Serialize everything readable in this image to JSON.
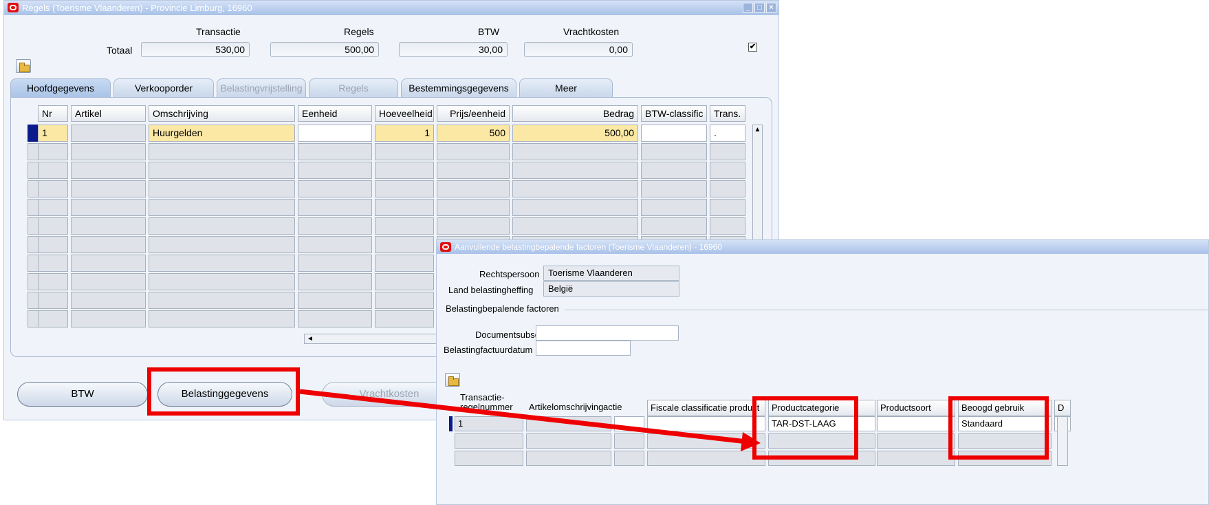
{
  "main_window": {
    "title": "Regels (Toerisme Vlaanderen) - Provincie Limburg, 16960",
    "window_buttons": [
      "_",
      "□",
      "×"
    ],
    "totals": {
      "label": "Totaal",
      "transactie_label": "Transactie",
      "transactie_value": "530,00",
      "regels_label": "Regels",
      "regels_value": "500,00",
      "btw_label": "BTW",
      "btw_value": "30,00",
      "vrachtkosten_label": "Vrachtkosten",
      "vrachtkosten_value": "0,00",
      "checkbox_checked": true,
      "checkbox_mark": "✔"
    },
    "tabs": [
      {
        "label": "Hoofdgegevens",
        "state": "active"
      },
      {
        "label": "Verkooporder",
        "state": "enabled"
      },
      {
        "label": "Belastingvrijstelling",
        "state": "disabled"
      },
      {
        "label": "Regels",
        "state": "disabled"
      },
      {
        "label": "Bestemmingsgegevens",
        "state": "enabled"
      },
      {
        "label": "Meer",
        "state": "enabled"
      }
    ],
    "table": {
      "columns": [
        "Nr",
        "Artikel",
        "Omschrijving",
        "Eenheid",
        "Hoeveelheid",
        "Prijs/eenheid",
        "Bedrag",
        "BTW-classific",
        "Trans."
      ],
      "rows": [
        {
          "nr": "1",
          "artikel": "",
          "omschrijving": "Huurgelden",
          "eenheid": "",
          "hoeveelheid": "1",
          "prijs": "500",
          "bedrag": "500,00",
          "btw": "",
          "trans": "."
        }
      ],
      "hscroll_arrow": "◄",
      "vscroll_arrow": "▲"
    },
    "buttons": {
      "btw": "BTW",
      "belastinggegevens": "Belastinggegevens",
      "vrachtkosten": "Vrachtkosten"
    }
  },
  "sub_window": {
    "title": "Aanvullende belastingbepalende factoren (Toerisme Vlaanderen) - 16960",
    "rechtspersoon_label": "Rechtspersoon",
    "rechtspersoon_value": "Toerisme Vlaanderen",
    "land_label": "Land belastingheffing",
    "land_value": "België",
    "section_label": "Belastingbepalende factoren",
    "documentsubsoort_label": "Documentsubsoort",
    "documentsubsoort_value": "",
    "factuurdatum_label": "Belastingfactuurdatum",
    "factuurdatum_value": "",
    "table": {
      "columns": [
        "Transactie-\nregelnummer",
        "Artikelomschrijving",
        "actie",
        "Fiscale classificatie product",
        "Productcategorie",
        "Productsoort",
        "Beoogd gebruik",
        "D"
      ],
      "col_regelnummer_line1": "Transactie-",
      "col_regelnummer_line2": "regelnummer",
      "rows": [
        {
          "regelnummer": "1",
          "artikelomschrijving": "",
          "actie": "",
          "fiscale": "",
          "productcategorie": "TAR-DST-LAAG",
          "productsoort": "",
          "beoogd_gebruik": "Standaard",
          "d": ""
        }
      ]
    }
  },
  "annotations": {
    "highlight_color": "#ee0000"
  }
}
